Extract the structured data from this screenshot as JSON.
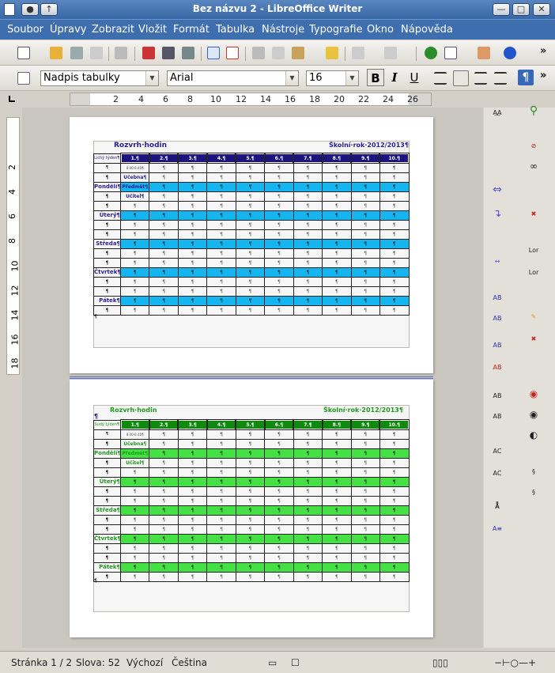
{
  "window": {
    "title": "Bez názvu 2 - LibreOffice Writer",
    "btn_min": "—",
    "btn_max": "□",
    "btn_close": "✕"
  },
  "menu": [
    "Soubor",
    "Úpravy",
    "Zobrazit",
    "Vložit",
    "Formát",
    "Tabulka",
    "Nástroje",
    "Typografie",
    "Okno",
    "Nápověda"
  ],
  "format": {
    "style": "Nadpis tabulky",
    "font": "Arial",
    "size": "16"
  },
  "format_buttons": {
    "bold": "B",
    "italic": "I",
    "underline": "U"
  },
  "ruler": {
    "h": [
      "2",
      "4",
      "6",
      "8",
      "10",
      "12",
      "14",
      "16",
      "18",
      "20",
      "22",
      "24",
      "26"
    ],
    "v": [
      "2",
      "4",
      "6",
      "8",
      "10",
      "12",
      "14",
      "16",
      "18"
    ]
  },
  "doc": {
    "pilcrow": "¶",
    "p1": {
      "title": "Rozvrh·hodin",
      "year": "Školní·rok·2012/2013¶",
      "week": "Lichý týden¶",
      "time": "8.00-8.45¶",
      "ucebna": "Učebna¶",
      "predmet": "Předmět¶",
      "ucitel": "Učitel¶"
    },
    "p2": {
      "title": "Rozvrh·hodin",
      "year": "Školní·rok·2012/2013¶",
      "week": "Sudý týden¶",
      "time": "8.00-8.45¶",
      "ucebna": "Učebna¶",
      "predmet": "Předmět¶",
      "ucitel": "Učitel¶"
    },
    "hours": [
      "1.¶",
      "2.¶",
      "3.¶",
      "4.¶",
      "5.¶",
      "6.¶",
      "7.¶",
      "8.¶",
      "9.¶",
      "10.¶"
    ],
    "days": [
      "Pondělí¶",
      "Úterý¶",
      "Středa¶",
      "Čtvrtek¶",
      "Pátek¶"
    ],
    "colors": {
      "p1_title": "#2a1e8f",
      "p1_head": "#1e1480",
      "p1_band": "#15b5f0",
      "p2_title": "#1f9a1f",
      "p2_head": "#0f8a0f",
      "p2_band": "#44e044"
    }
  },
  "sidebar_icons": [
    "fontwork-icon",
    "find-icon",
    "link-icon",
    "chain-icon",
    "cursor-icon",
    "anchor-icon",
    "binoculars-icon",
    "arrow-icon",
    "lorem-icon",
    "radio-icon",
    "circle-icon",
    "scroll-icon"
  ],
  "status": {
    "page": "Stránka 1 / 2",
    "words": "Slova: 52",
    "style": "Výchozí",
    "lang": "Čeština"
  }
}
